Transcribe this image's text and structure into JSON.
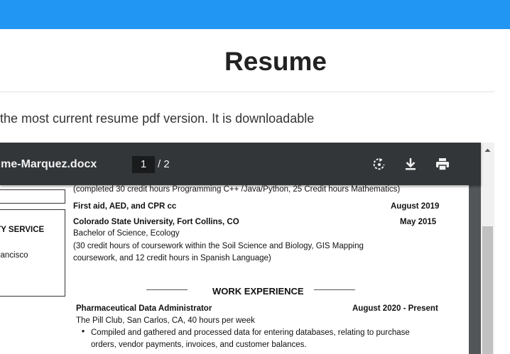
{
  "page": {
    "title": "Resume",
    "intro": "the most current resume pdf version. It is downloadable"
  },
  "viewer": {
    "filename": "Resume-Marquez.docx",
    "current_page": "1",
    "page_total": "/ 2"
  },
  "doc": {
    "completed_line": "(completed 30 credit hours Programming C++ /Java/Python, 25 Credit hours Mathematics)",
    "first_aid": "First aid, AED, and CPR cc",
    "first_aid_date": "August 2019",
    "csu_name": "Colorado State University, Fort Collins, CO",
    "csu_date": "May 2015",
    "degree": "Bachelor of Science, Ecology",
    "coursework_1": "(30 credit hours of coursework within the Soil Science and Biology, GIS Mapping",
    "coursework_2": "coursework, and 12 credit hours in Spanish Language)",
    "side_service": "COMMUNITY SERVICE",
    "side_location": "San Francisco",
    "work_heading": "WORK EXPERIENCE",
    "job_title": "Pharmaceutical Data Administrator",
    "job_dates": "August 2020 - Present",
    "job_place": "The Pill Club, San Carlos, CA, 40 hours per week",
    "bullet_1a": "Compiled and gathered and processed  data for entering databases, relating to purchase",
    "bullet_1b": "orders, vendor payments, invoices, and customer balances."
  },
  "colors": {
    "topbar": "#2196f3",
    "toolbar": "#323639",
    "doc_background": "#525659"
  },
  "icons": {
    "rotate": "rotate-icon",
    "download": "download-icon",
    "print": "print-icon"
  }
}
